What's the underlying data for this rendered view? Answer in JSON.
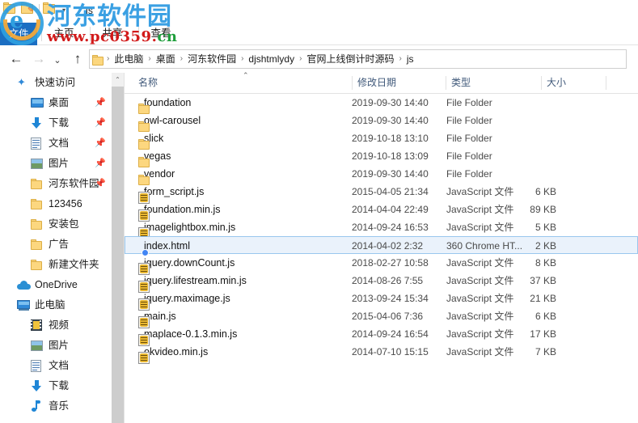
{
  "window": {
    "title": "js",
    "quick_access_toolbar": [
      {
        "name": "properties-icon",
        "glyph": "★"
      },
      {
        "name": "new-folder-icon",
        "glyph": "✎"
      },
      {
        "name": "customize-caret-icon",
        "glyph": "▾"
      }
    ]
  },
  "ribbon": {
    "tabs": [
      {
        "label": "文件",
        "key": "file",
        "active": true
      },
      {
        "label": "主页",
        "key": "home",
        "active": false
      },
      {
        "label": "共享",
        "key": "share",
        "active": false
      },
      {
        "label": "查看",
        "key": "view",
        "active": false
      }
    ]
  },
  "navigation": {
    "back_glyph": "←",
    "forward_glyph": "→",
    "recent_glyph": "⌄",
    "up_glyph": "↑",
    "separator": "›",
    "breadcrumbs": [
      "此电脑",
      "桌面",
      "河东软件园",
      "djshtmlydy",
      "官网上线倒计时源码",
      "js"
    ]
  },
  "sidebar": {
    "scroll_up_glyph": "⌃",
    "pin_glyph": "📌",
    "items": [
      {
        "label": "快速访问",
        "icon": "quick-access-star-icon",
        "level": 0,
        "pinned": false
      },
      {
        "label": "桌面",
        "icon": "desktop-icon",
        "level": 1,
        "pinned": true
      },
      {
        "label": "下载",
        "icon": "downloads-icon",
        "level": 1,
        "pinned": true
      },
      {
        "label": "文档",
        "icon": "documents-icon",
        "level": 1,
        "pinned": true
      },
      {
        "label": "图片",
        "icon": "pictures-icon",
        "level": 1,
        "pinned": true
      },
      {
        "label": "河东软件园",
        "icon": "folder-icon",
        "level": 1,
        "pinned": true
      },
      {
        "label": "123456",
        "icon": "folder-icon",
        "level": 1,
        "pinned": false
      },
      {
        "label": "安装包",
        "icon": "folder-icon",
        "level": 1,
        "pinned": false
      },
      {
        "label": "广告",
        "icon": "folder-icon",
        "level": 1,
        "pinned": false
      },
      {
        "label": "新建文件夹",
        "icon": "folder-icon",
        "level": 1,
        "pinned": false
      },
      {
        "label": "OneDrive",
        "icon": "onedrive-cloud-icon",
        "level": 0,
        "pinned": false
      },
      {
        "label": "此电脑",
        "icon": "this-pc-icon",
        "level": 0,
        "pinned": false
      },
      {
        "label": "视频",
        "icon": "videos-icon",
        "level": 1,
        "pinned": false
      },
      {
        "label": "图片",
        "icon": "pictures-icon",
        "level": 1,
        "pinned": false
      },
      {
        "label": "文档",
        "icon": "documents-icon",
        "level": 1,
        "pinned": false
      },
      {
        "label": "下载",
        "icon": "downloads-icon",
        "level": 1,
        "pinned": false
      },
      {
        "label": "音乐",
        "icon": "music-icon",
        "level": 1,
        "pinned": false
      }
    ]
  },
  "file_list": {
    "sort_indicator": "⌃",
    "columns": [
      {
        "label": "名称",
        "key": "name"
      },
      {
        "label": "修改日期",
        "key": "date"
      },
      {
        "label": "类型",
        "key": "type"
      },
      {
        "label": "大小",
        "key": "size"
      }
    ],
    "rows": [
      {
        "name": "foundation",
        "date": "2019-09-30 14:40",
        "type": "File Folder",
        "size": "",
        "icon": "folder-icon",
        "selected": false
      },
      {
        "name": "owl-carousel",
        "date": "2019-09-30 14:40",
        "type": "File Folder",
        "size": "",
        "icon": "folder-icon",
        "selected": false
      },
      {
        "name": "slick",
        "date": "2019-10-18 13:10",
        "type": "File Folder",
        "size": "",
        "icon": "folder-icon",
        "selected": false
      },
      {
        "name": "vegas",
        "date": "2019-10-18 13:09",
        "type": "File Folder",
        "size": "",
        "icon": "folder-icon",
        "selected": false
      },
      {
        "name": "vendor",
        "date": "2019-09-30 14:40",
        "type": "File Folder",
        "size": "",
        "icon": "folder-icon",
        "selected": false
      },
      {
        "name": "form_script.js",
        "date": "2015-04-05 21:34",
        "type": "JavaScript 文件",
        "size": "6 KB",
        "icon": "javascript-file-icon",
        "selected": false
      },
      {
        "name": "foundation.min.js",
        "date": "2014-04-04 22:49",
        "type": "JavaScript 文件",
        "size": "89 KB",
        "icon": "javascript-file-icon",
        "selected": false
      },
      {
        "name": "imagelightbox.min.js",
        "date": "2014-09-24 16:53",
        "type": "JavaScript 文件",
        "size": "5 KB",
        "icon": "javascript-file-icon",
        "selected": false
      },
      {
        "name": "index.html",
        "date": "2014-04-02 2:32",
        "type": "360 Chrome HT...",
        "size": "2 KB",
        "icon": "chrome-html-file-icon",
        "selected": true
      },
      {
        "name": "jquery.downCount.js",
        "date": "2018-02-27 10:58",
        "type": "JavaScript 文件",
        "size": "8 KB",
        "icon": "javascript-file-icon",
        "selected": false
      },
      {
        "name": "jquery.lifestream.min.js",
        "date": "2014-08-26 7:55",
        "type": "JavaScript 文件",
        "size": "37 KB",
        "icon": "javascript-file-icon",
        "selected": false
      },
      {
        "name": "jquery.maximage.js",
        "date": "2013-09-24 15:34",
        "type": "JavaScript 文件",
        "size": "21 KB",
        "icon": "javascript-file-icon",
        "selected": false
      },
      {
        "name": "main.js",
        "date": "2015-04-06 7:36",
        "type": "JavaScript 文件",
        "size": "6 KB",
        "icon": "javascript-file-icon",
        "selected": false
      },
      {
        "name": "maplace-0.1.3.min.js",
        "date": "2014-09-24 16:54",
        "type": "JavaScript 文件",
        "size": "17 KB",
        "icon": "javascript-file-icon",
        "selected": false
      },
      {
        "name": "okvideo.min.js",
        "date": "2014-07-10 15:15",
        "type": "JavaScript 文件",
        "size": "7 KB",
        "icon": "javascript-file-icon",
        "selected": false
      }
    ]
  },
  "watermark": {
    "brand": "河东软件园",
    "url_part1": "www.pc0359.",
    "url_part2": "cn",
    "logo_glyph": "e"
  },
  "colors": {
    "accent": "#1b6ec2",
    "selection_fill": "#eaf2fb",
    "selection_border": "#99c7ee",
    "folder": "#fcd77f",
    "header_text": "#40597a",
    "watermark_blue": "#3aa0e3",
    "watermark_red": "#d21a1a",
    "watermark_green": "#1f9e3c"
  }
}
